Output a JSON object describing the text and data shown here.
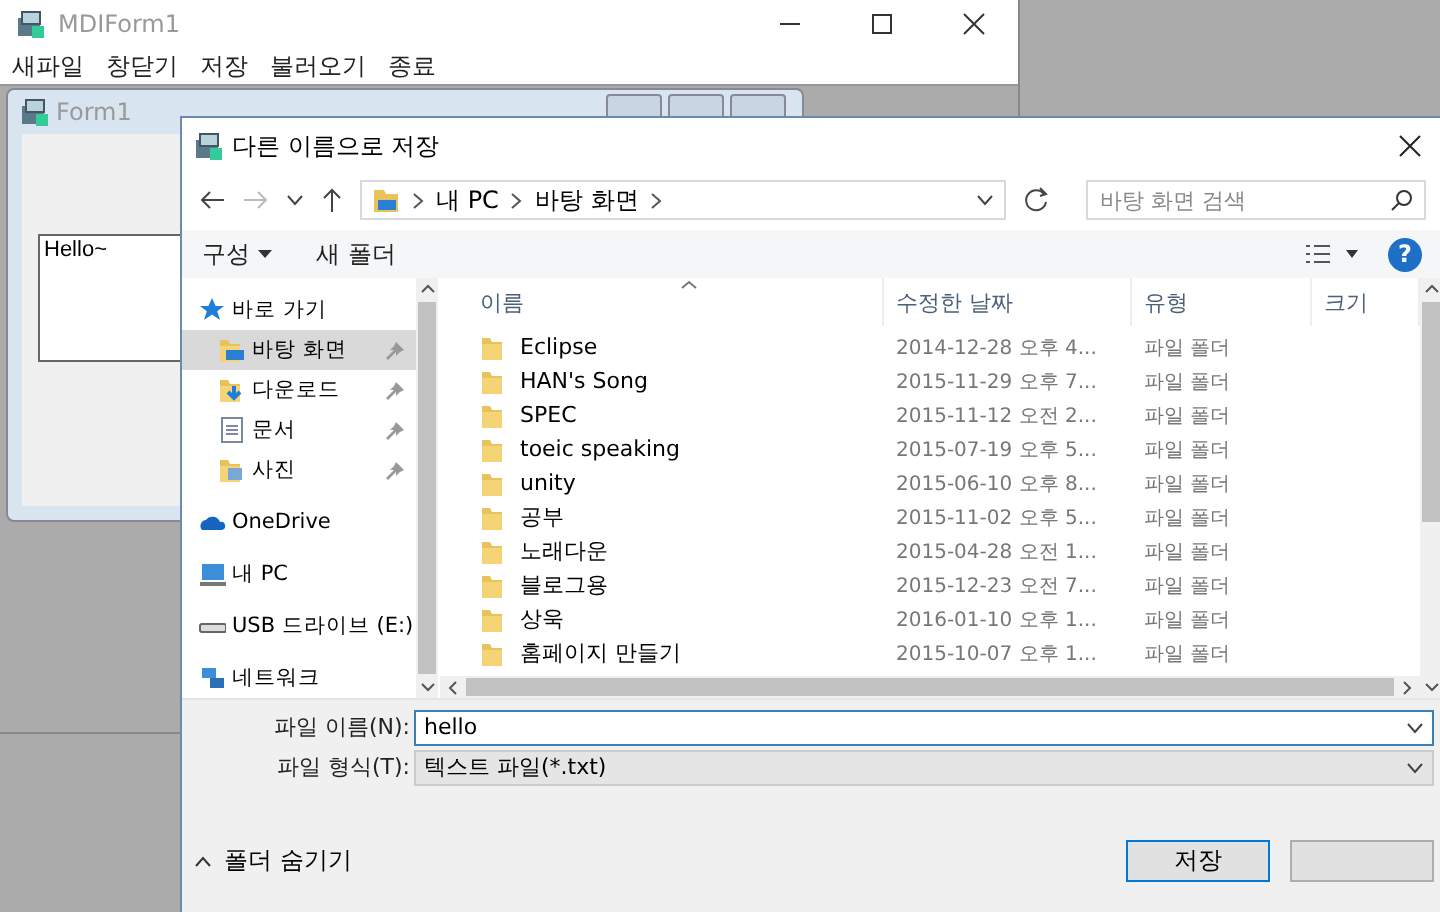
{
  "mdi_window": {
    "title": "MDIForm1",
    "menu": [
      "새파일",
      "창닫기",
      "저장",
      "불러오기",
      "종료"
    ],
    "child_window": {
      "title": "Form1",
      "text_content": "Hello~"
    }
  },
  "dialog": {
    "title": "다른 이름으로 저장",
    "path": [
      "내 PC",
      "바탕 화면"
    ],
    "search": {
      "placeholder": "바탕 화면 검색"
    },
    "toolbar": {
      "organize": "구성",
      "new_folder": "새 폴더",
      "help": "?"
    },
    "sidebar": [
      {
        "label": "바로 가기",
        "kind": "star",
        "selected": false,
        "children": [
          {
            "label": "바탕 화면",
            "kind": "desktop",
            "selected": true,
            "pinned": true
          },
          {
            "label": "다운로드",
            "kind": "download",
            "selected": false,
            "pinned": true
          },
          {
            "label": "문서",
            "kind": "document",
            "selected": false,
            "pinned": true
          },
          {
            "label": "사진",
            "kind": "picture",
            "selected": false,
            "pinned": true
          }
        ]
      },
      {
        "label": "OneDrive",
        "kind": "cloud",
        "selected": false
      },
      {
        "label": "내 PC",
        "kind": "pc",
        "selected": false
      },
      {
        "label": "USB 드라이브 (E:)",
        "kind": "drive",
        "selected": false
      },
      {
        "label": "네트워크",
        "kind": "network",
        "selected": false
      }
    ],
    "columns": [
      "이름",
      "수정한 날짜",
      "유형",
      "크기"
    ],
    "rows": [
      {
        "name": "Eclipse",
        "date": "2014-12-28 오후 4...",
        "type": "파일 폴더"
      },
      {
        "name": "HAN's Song",
        "date": "2015-11-29 오후 7...",
        "type": "파일 폴더"
      },
      {
        "name": "SPEC",
        "date": "2015-11-12 오전 2...",
        "type": "파일 폴더"
      },
      {
        "name": "toeic speaking",
        "date": "2015-07-19 오후 5...",
        "type": "파일 폴더"
      },
      {
        "name": "unity",
        "date": "2015-06-10 오후 8...",
        "type": "파일 폴더"
      },
      {
        "name": "공부",
        "date": "2015-11-02 오후 5...",
        "type": "파일 폴더"
      },
      {
        "name": "노래다운",
        "date": "2015-04-28 오전 1...",
        "type": "파일 폴더"
      },
      {
        "name": "블로그용",
        "date": "2015-12-23 오전 7...",
        "type": "파일 폴더"
      },
      {
        "name": "상욱",
        "date": "2016-01-10 오후 1...",
        "type": "파일 폴더"
      },
      {
        "name": "홈페이지 만들기",
        "date": "2015-10-07 오후 1...",
        "type": "파일 폴더"
      }
    ],
    "file_name": {
      "label": "파일 이름(N):",
      "value": "hello"
    },
    "file_type": {
      "label": "파일 형식(T):",
      "value": "텍스트 파일(*.txt)"
    },
    "hide_folders": "폴더 숨기기",
    "buttons": [
      "저장"
    ]
  }
}
